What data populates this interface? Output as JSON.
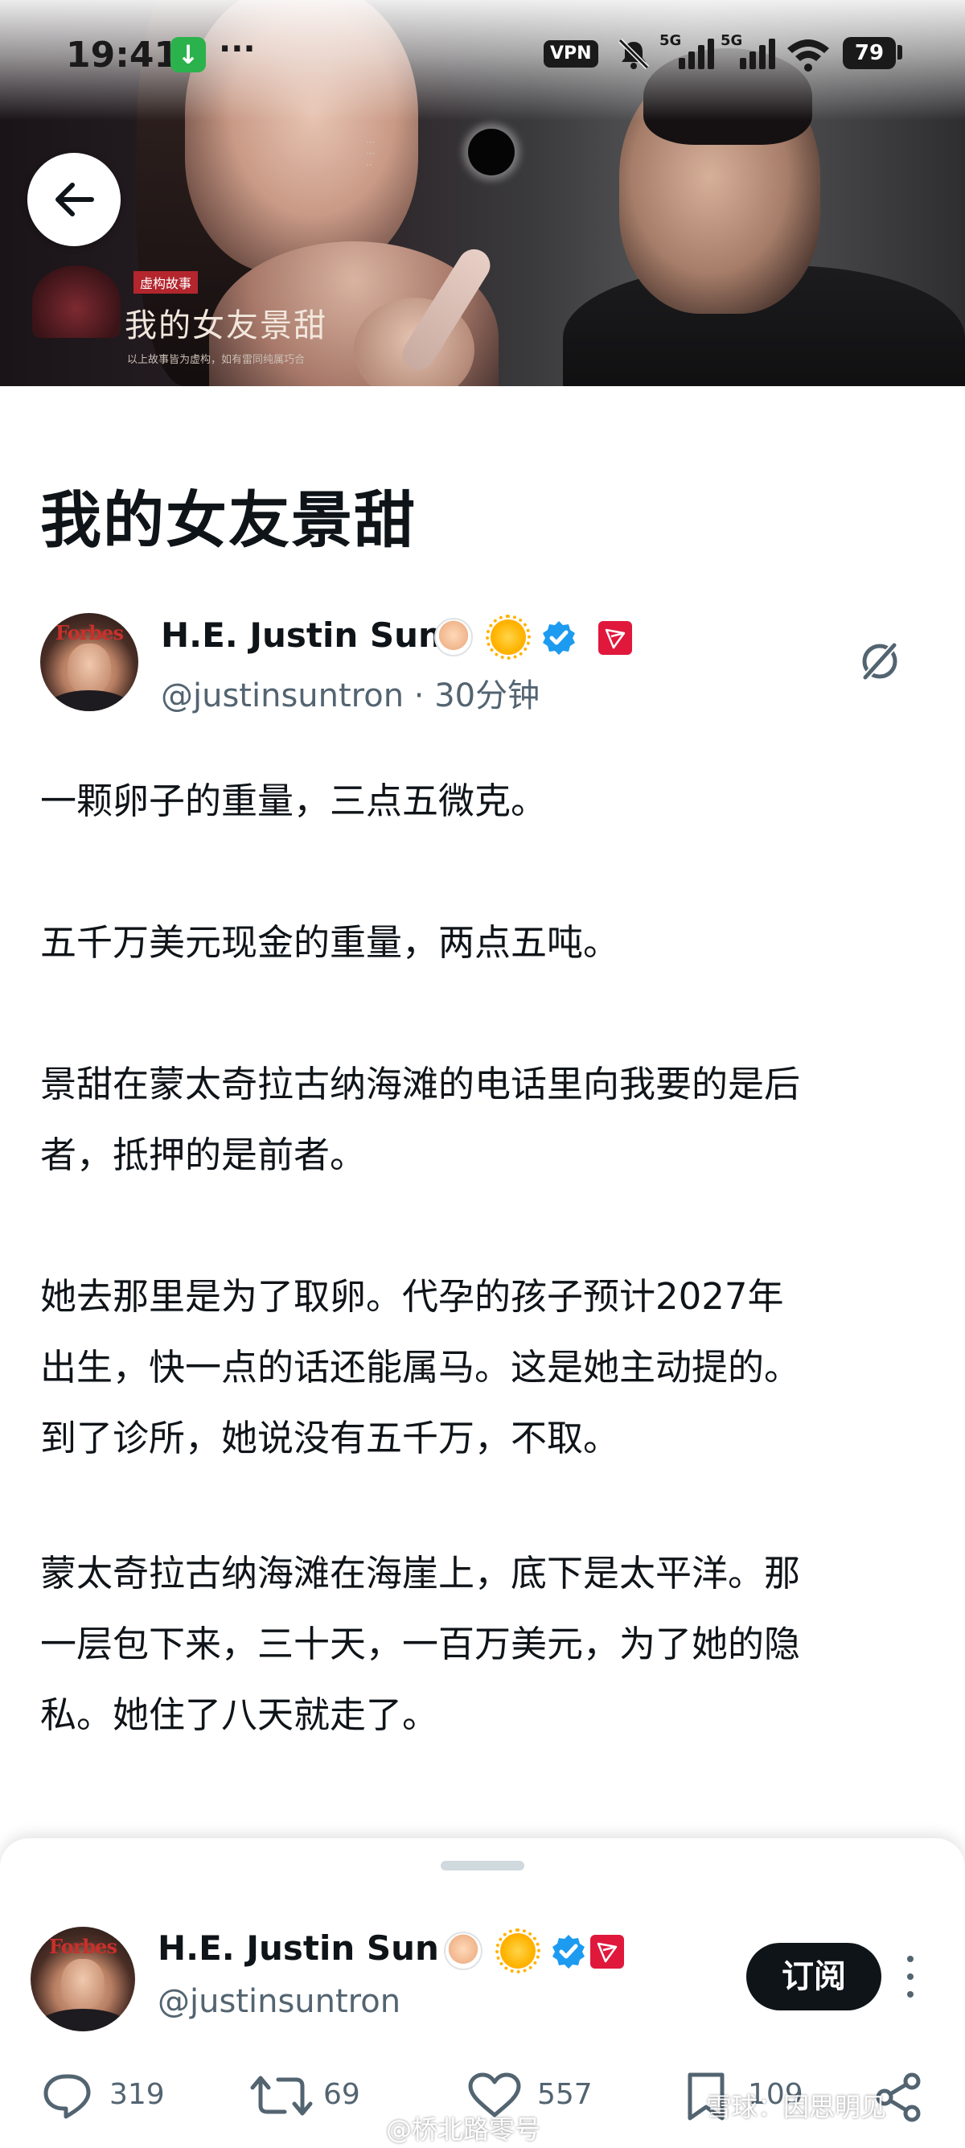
{
  "status_bar": {
    "time": "19:41",
    "download_icon": "download-arrow",
    "more": "···",
    "vpn": "VPN",
    "signal_1": "5G",
    "signal_2": "5G",
    "battery": "79"
  },
  "banner": {
    "poster_tag": "虚构故事",
    "poster_title": "我的女友景甜",
    "poster_note": "以上故事皆为虚构，如有雷同纯属巧合",
    "back_icon": "arrow-left-icon"
  },
  "article": {
    "title": "我的女友景甜",
    "author": {
      "name": "H.E. Justin Sun",
      "handle_time": "@justinsuntron · 30分钟",
      "avatar_text": "Forbes",
      "badges": [
        "person-emoji",
        "sun-emoji",
        "verified",
        "tron"
      ]
    },
    "paragraphs": [
      [
        "一颗卵子的重量，三点五微克。"
      ],
      [
        "五千万美元现金的重量，两点五吨。"
      ],
      [
        "景甜在蒙太奇拉古纳海滩的电话里向我要的是后",
        "者，抵押的是前者。"
      ],
      [
        "她去那里是为了取卵。代孕的孩子预计2027年",
        "出生，快一点的话还能属马。这是她主动提的。",
        "到了诊所，她说没有五千万，不取。"
      ],
      [
        "蒙太奇拉古纳海滩在海崖上，底下是太平洋。那",
        "一层包下来，三十天，一百万美元，为了她的隐",
        "私。她住了八天就走了。"
      ]
    ]
  },
  "sheet": {
    "author_name": "H.E. Justin Sun",
    "author_handle": "@justinsuntron",
    "subscribe": "订阅",
    "actions": {
      "replies": "319",
      "reposts": "69",
      "likes": "557",
      "bookmarks": "109"
    }
  },
  "watermarks": {
    "weibo": "@桥北路零号",
    "xueqiu": "雪球：因思明见"
  },
  "colors": {
    "text": "#0f1419",
    "secondary": "#536471",
    "verified_blue": "#1d9bf0",
    "tron_red": "#e0183c"
  }
}
